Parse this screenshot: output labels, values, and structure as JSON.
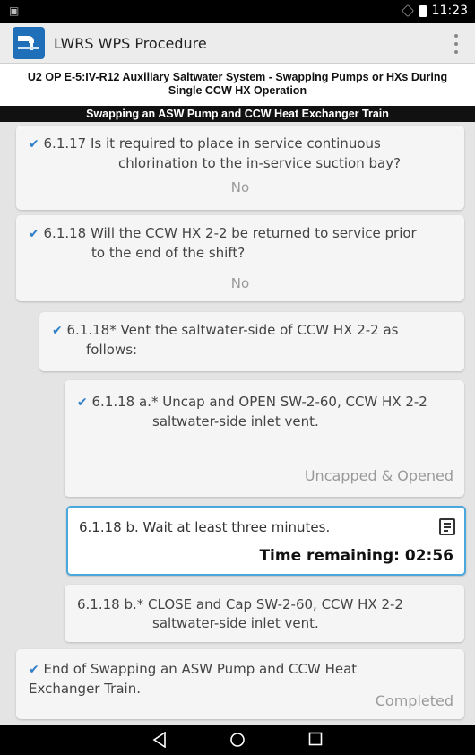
{
  "status_bar": {
    "time": "11:23"
  },
  "app_bar": {
    "title": "LWRS WPS Procedure"
  },
  "procedure": {
    "title_line1": "U2 OP E-5:IV-R12 Auxiliary Saltwater System - Swapping Pumps or HXs During",
    "title_line2": "Single CCW HX Operation",
    "section": "Swapping an ASW Pump and CCW Heat Exchanger Train"
  },
  "steps": [
    {
      "line1": "6.1.17 Is it required to place in service continuous",
      "line2": "chlorination to the in-service suction bay?",
      "answer": "No",
      "checked": true
    },
    {
      "line1": "6.1.18 Will the CCW HX 2-2 be returned to service prior",
      "line2": "to the end of the shift?",
      "answer": "No",
      "checked": true
    },
    {
      "line1": "6.1.18* Vent the saltwater-side of CCW HX 2-2 as",
      "line2": "follows:",
      "checked": true
    },
    {
      "line1": "6.1.18 a.* Uncap and OPEN SW-2-60, CCW HX 2-2",
      "line2": "saltwater-side inlet vent.",
      "answer": "Uncapped & Opened",
      "checked": true
    },
    {
      "line1": "6.1.18 b. Wait at least three minutes.",
      "timer": "Time remaining: 02:56",
      "active": true
    },
    {
      "line1": "6.1.18 b.* CLOSE and Cap SW-2-60, CCW HX 2-2",
      "line2": "saltwater-side inlet vent."
    },
    {
      "line1": "End of Swapping an ASW Pump and CCW Heat",
      "line2": "Exchanger Train.",
      "answer": "Completed",
      "checked": true
    }
  ],
  "colors": {
    "accent": "#4aa8dc",
    "check": "#2f7fc8",
    "app_logo": "#1f6fb9"
  }
}
